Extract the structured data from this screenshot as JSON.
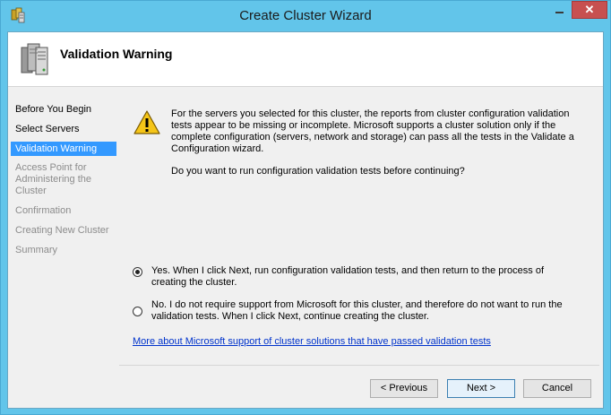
{
  "window": {
    "title": "Create Cluster Wizard",
    "icons": {
      "app": "cluster-wizard-icon",
      "minimize": "minimize-icon",
      "close": "close-icon"
    },
    "close_glyph": "✕"
  },
  "header": {
    "title": "Validation Warning",
    "icon": "server-stack-icon"
  },
  "nav": {
    "items": [
      {
        "label": "Before You Begin",
        "state": "done"
      },
      {
        "label": "Select Servers",
        "state": "done"
      },
      {
        "label": "Validation Warning",
        "state": "active"
      },
      {
        "label": "Access Point for Administering the Cluster",
        "state": "disabled"
      },
      {
        "label": "Confirmation",
        "state": "disabled"
      },
      {
        "label": "Creating New Cluster",
        "state": "disabled"
      },
      {
        "label": "Summary",
        "state": "disabled"
      }
    ]
  },
  "content": {
    "warning_icon": "warning-triangle-icon",
    "message": "For the servers you selected for this cluster, the reports from cluster configuration validation tests appear to be missing or incomplete.  Microsoft supports a cluster solution only if the complete configuration (servers, network and storage) can pass all the tests in the Validate a Configuration wizard.",
    "question": "Do you want to run configuration validation tests before continuing?",
    "options": [
      {
        "label": "Yes.  When I click Next, run configuration validation tests, and then return to the process of creating the cluster.",
        "selected": true
      },
      {
        "label": "No.  I do not require support from Microsoft for this cluster, and therefore do not want to run the validation tests.  When I click Next, continue creating the cluster.",
        "selected": false
      }
    ],
    "link": "More about Microsoft support of cluster solutions that have passed validation tests"
  },
  "buttons": {
    "previous": "< Previous",
    "next": "Next >",
    "cancel": "Cancel"
  },
  "colors": {
    "titlebar": "#62c5ea",
    "close": "#c75050",
    "nav_active": "#3399ff",
    "link": "#0033cc"
  }
}
